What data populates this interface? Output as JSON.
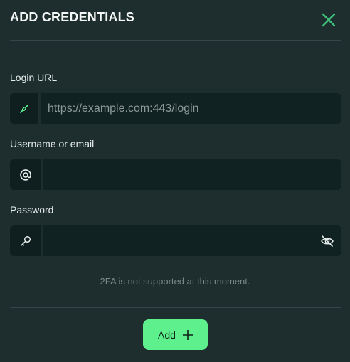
{
  "dialog": {
    "title": "ADD CREDENTIALS",
    "close_icon": "close-icon",
    "accent_color": "#5ef08d"
  },
  "fields": {
    "login_url": {
      "label": "Login URL",
      "placeholder": "https://example.com:443/login",
      "value": "",
      "icon": "link-icon"
    },
    "username": {
      "label": "Username or email",
      "placeholder": "",
      "value": "",
      "icon": "at-icon"
    },
    "password": {
      "label": "Password",
      "placeholder": "",
      "value": "",
      "icon": "key-icon",
      "toggle_icon": "eye-off-icon"
    }
  },
  "note": "2FA is not supported at this moment.",
  "actions": {
    "add_label": "Add",
    "add_icon": "plus-icon"
  }
}
